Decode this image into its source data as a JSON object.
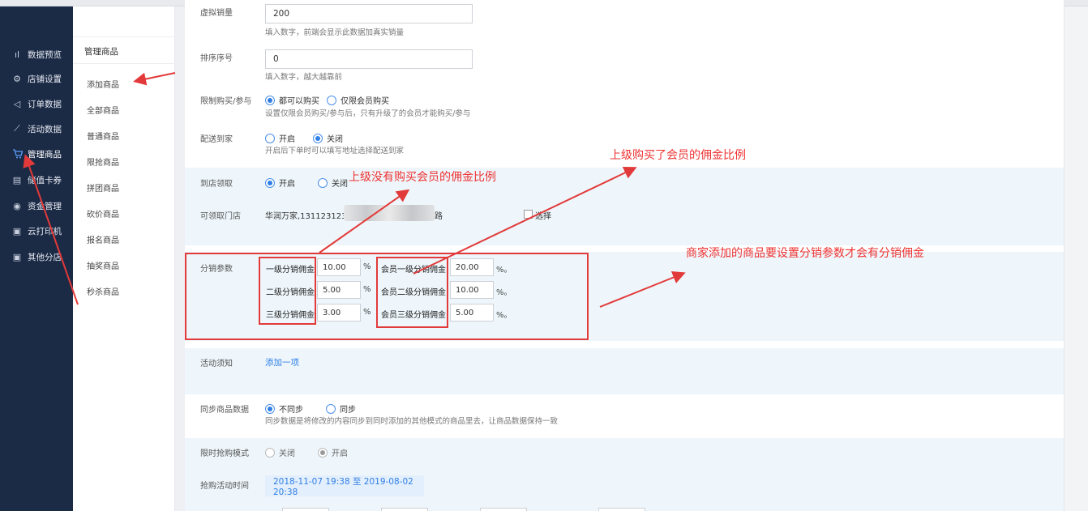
{
  "nav": {
    "items": [
      {
        "icon": "bar-chart-icon",
        "glyph": "ıl",
        "label": "数据预览"
      },
      {
        "icon": "gear-icon",
        "glyph": "⚙",
        "label": "店铺设置"
      },
      {
        "icon": "send-icon",
        "glyph": "◁",
        "label": "订单数据"
      },
      {
        "icon": "line-chart-icon",
        "glyph": "⟋",
        "label": "活动数据"
      },
      {
        "icon": "cart-icon",
        "glyph": "🛒",
        "label": "管理商品"
      },
      {
        "icon": "card-icon",
        "glyph": "▤",
        "label": "储值卡券"
      },
      {
        "icon": "coin-icon",
        "glyph": "◉",
        "label": "资金管理"
      },
      {
        "icon": "printer-icon",
        "glyph": "▣",
        "label": "云打印机"
      },
      {
        "icon": "share-icon",
        "glyph": "▣",
        "label": "其他分店"
      }
    ]
  },
  "subnav": {
    "title": "管理商品",
    "items": [
      "添加商品",
      "全部商品",
      "普通商品",
      "限抢商品",
      "拼团商品",
      "砍价商品",
      "报名商品",
      "抽奖商品",
      "秒杀商品"
    ]
  },
  "form": {
    "virtual_sales": {
      "label": "虚拟销量",
      "value": "200",
      "hint": "填入数字，前端会显示此数据加真实销量"
    },
    "sort_order": {
      "label": "排序序号",
      "value": "0",
      "hint": "填入数字，越大越靠前"
    },
    "purchase_limit": {
      "label": "限制购买/参与",
      "opt_all": "都可以购买",
      "opt_member": "仅限会员购买",
      "hint": "设置仅限会员购买/参与后，只有升级了的会员才能购买/参与"
    },
    "delivery": {
      "label": "配送到家",
      "opt_on": "开启",
      "opt_off": "关闭",
      "hint": "开启后下单时可以填写地址选择配送到家"
    },
    "pickup": {
      "label": "到店领取",
      "opt_on": "开启",
      "opt_off": "关闭"
    },
    "pickup_store": {
      "label": "可领取门店",
      "store": "华润万家,131123123",
      "suffix": "路",
      "select": "选择"
    },
    "distribution": {
      "label": "分销参数",
      "levels": [
        {
          "label": "一级分销佣金",
          "value": "10.00",
          "unit": "%"
        },
        {
          "label": "二级分销佣金",
          "value": "5.00",
          "unit": "%"
        },
        {
          "label": "三级分销佣金",
          "value": "3.00",
          "unit": "%"
        }
      ],
      "member_levels": [
        {
          "label": "会员一级分销佣金",
          "value": "20.00",
          "unit": "%。"
        },
        {
          "label": "会员二级分销佣金",
          "value": "10.00",
          "unit": "%。"
        },
        {
          "label": "会员三级分销佣金",
          "value": "5.00",
          "unit": "%。"
        }
      ]
    },
    "notice": {
      "label": "活动须知",
      "add": "添加一项"
    },
    "sync": {
      "label": "同步商品数据",
      "opt_no": "不同步",
      "opt_yes": "同步",
      "hint": "同步数据是将修改的内容同步到同时添加的其他模式的商品里去，让商品数据保持一致"
    },
    "flash_mode": {
      "label": "限时抢购模式",
      "opt_off": "关闭",
      "opt_on": "开启"
    },
    "flash_time": {
      "label": "抢购活动时间",
      "range": "2018-11-07 19:38 至 2019-08-02 20:38"
    }
  },
  "annotations": {
    "non_member": "上级没有购买会员的佣金比例",
    "member": "上级购买了会员的佣金比例",
    "merchant": "商家添加的商品要设置分销参数才会有分销佣金"
  },
  "colors": {
    "nav_bg": "#1b2a45",
    "accent": "#2f7ee6",
    "annotation": "#ee3232",
    "band": "#eef6fb"
  }
}
